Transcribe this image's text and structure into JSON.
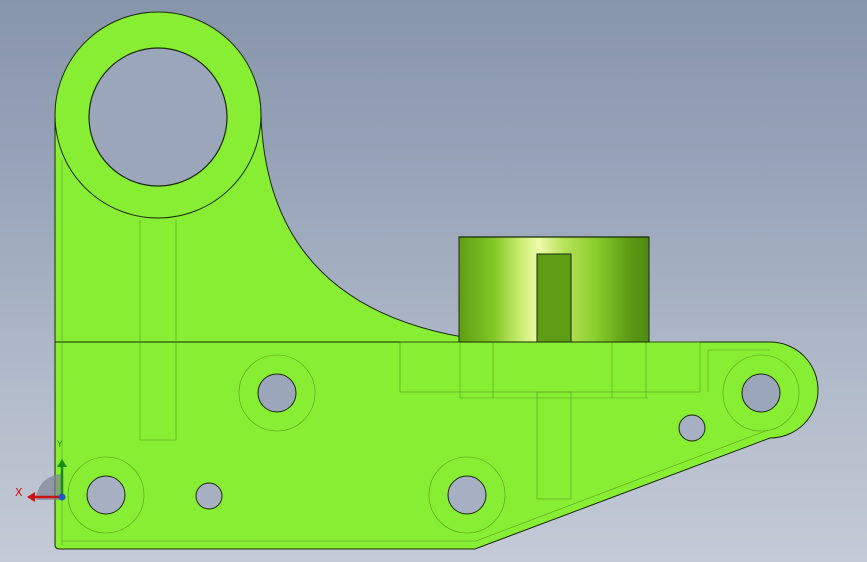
{
  "viewport": {
    "background_top": "#8795ab",
    "background_bottom": "#c4cad6"
  },
  "part": {
    "color": "#88ee33",
    "edge_color": "#1a2a0a",
    "boss_shade": "#e8f8a0"
  },
  "triad": {
    "x_label": "X",
    "y_label": "Y",
    "x_color": "#cc1111",
    "y_color": "#1a8a1a",
    "z_color": "#2255cc"
  }
}
